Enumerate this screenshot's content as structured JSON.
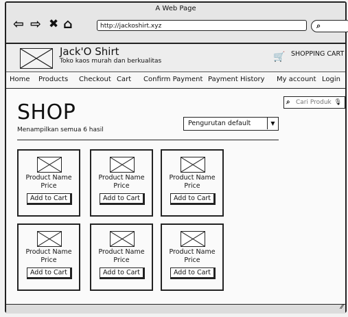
{
  "window": {
    "title": "A Web Page",
    "url": "http://jackoshirt.xyz"
  },
  "nav_icons": [
    "back-arrow-icon",
    "forward-arrow-icon",
    "close-icon",
    "home-icon"
  ],
  "header": {
    "brand": "Jack'O Shirt",
    "tagline": "Toko kaos murah dan berkualitas",
    "cart_label": "SHOPPING CART"
  },
  "menu": [
    "Home",
    "Products",
    "Checkout",
    "Cart",
    "Confirm Payment",
    "Payment History",
    "My account",
    "Login"
  ],
  "shop": {
    "title": "SHOP",
    "result_text": "Menampilkan semua 6 hasil",
    "sort_selected": "Pengurutan default",
    "search_placeholder": "Cari Produk"
  },
  "products": [
    {
      "name": "Product Name",
      "price": "Price",
      "button": "Add to Cart"
    },
    {
      "name": "Product Name",
      "price": "Price",
      "button": "Add to Cart"
    },
    {
      "name": "Product Name",
      "price": "Price",
      "button": "Add to Cart"
    },
    {
      "name": "Product Name",
      "price": "Price",
      "button": "Add to Cart"
    },
    {
      "name": "Product Name",
      "price": "Price",
      "button": "Add to Cart"
    },
    {
      "name": "Product Name",
      "price": "Price",
      "button": "Add to Cart"
    }
  ]
}
